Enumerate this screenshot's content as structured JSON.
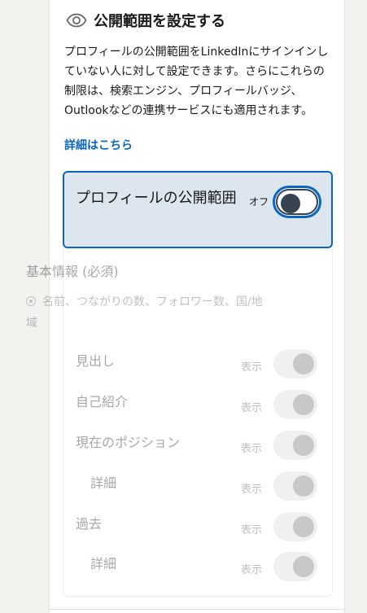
{
  "header": {
    "title": "公開範囲を設定する",
    "icon": "eye-icon"
  },
  "description": "プロフィールの公開範囲をLinkedInにサインインしていない人に対して設定できます。さらにこれらの制限は、検索エンジン、プロフィールバッジ、Outlookなどの連携サービスにも適用されます。",
  "learn_more": "詳細はこちら",
  "master_toggle": {
    "label": "プロフィールの公開範囲",
    "state_label": "オフ",
    "on": false
  },
  "basic_info": {
    "title": "基本情報 (必須)",
    "item": "名前、つながりの数、フォロワー数、国/地域"
  },
  "rows": [
    {
      "label": "見出し",
      "show_label": "表示",
      "on": true,
      "enabled": false
    },
    {
      "label": "自己紹介",
      "show_label": "表示",
      "on": true,
      "enabled": false
    },
    {
      "label": "現在のポジション",
      "show_label": "表示",
      "on": true,
      "enabled": false
    },
    {
      "label": "詳細",
      "show_label": "表示",
      "on": true,
      "enabled": false
    },
    {
      "label": "過去",
      "show_label": "表示",
      "on": true,
      "enabled": false
    },
    {
      "label": "詳細",
      "show_label": "表示",
      "on": true,
      "enabled": false
    }
  ],
  "colors": {
    "accent": "#0a66c2",
    "master_bg": "#dde6ee",
    "toggle_dark": "#38434f"
  }
}
